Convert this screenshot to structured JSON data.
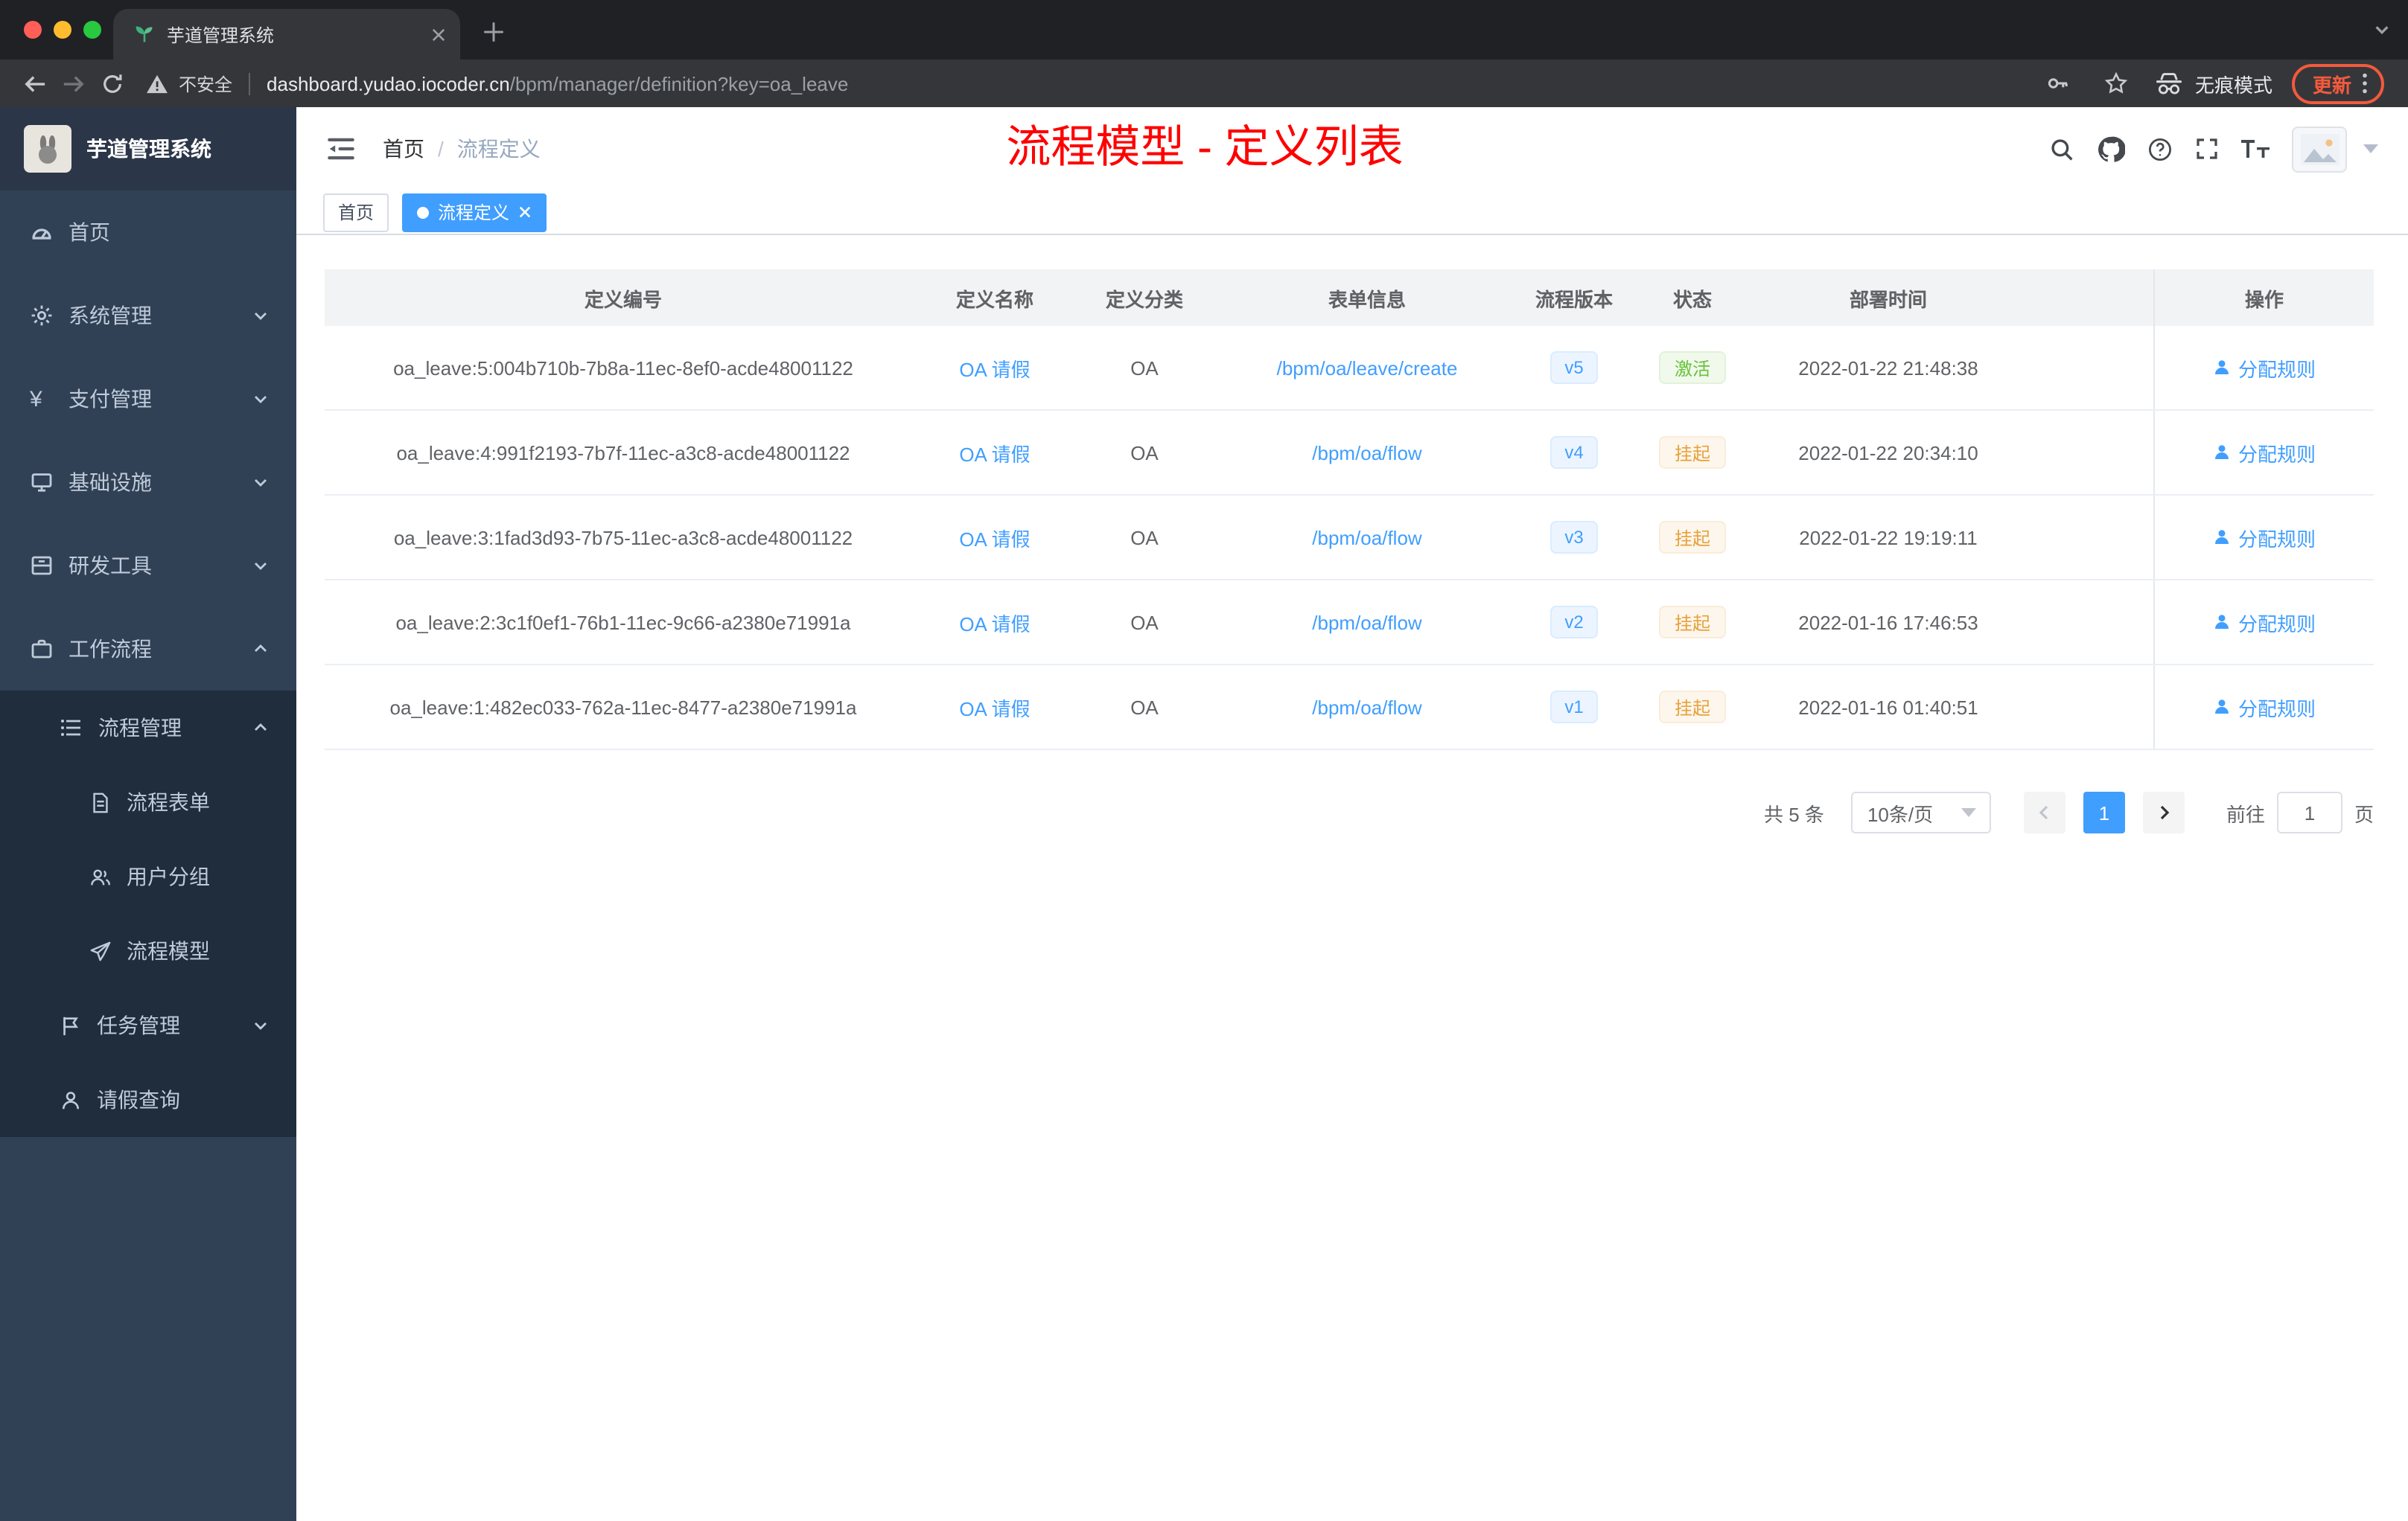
{
  "colors": {
    "accent": "#409eff",
    "success": "#67c23a",
    "warning": "#e6a23c",
    "page_title_red": "#ff0000",
    "update_badge": "#f25a3c",
    "sidebar_bg": "#304156",
    "submenu_bg": "#1f2d3d"
  },
  "browser": {
    "tab_title": "芋道管理系统",
    "security_label": "不安全",
    "url_host": "dashboard.yudao.iocoder.cn",
    "url_path": "/bpm/manager/definition?key=oa_leave",
    "incognito_label": "无痕模式",
    "update_label": "更新"
  },
  "sidebar": {
    "logo_title": "芋道管理系统",
    "items": [
      {
        "label": "首页"
      },
      {
        "label": "系统管理"
      },
      {
        "label": "支付管理"
      },
      {
        "label": "基础设施"
      },
      {
        "label": "研发工具"
      },
      {
        "label": "工作流程"
      },
      {
        "label": "流程管理"
      },
      {
        "label": "流程表单"
      },
      {
        "label": "用户分组"
      },
      {
        "label": "流程模型"
      },
      {
        "label": "任务管理"
      },
      {
        "label": "请假查询"
      }
    ]
  },
  "navbar": {
    "breadcrumb": [
      {
        "label": "首页"
      },
      {
        "label": "流程定义"
      }
    ],
    "separator": "/",
    "title": "流程模型 - 定义列表"
  },
  "tags_view": [
    {
      "label": "首页"
    },
    {
      "label": "流程定义"
    }
  ],
  "table": {
    "columns": [
      "定义编号",
      "定义名称",
      "定义分类",
      "表单信息",
      "流程版本",
      "状态",
      "部署时间",
      "操作"
    ],
    "rows": [
      {
        "id": "oa_leave:5:004b710b-7b8a-11ec-8ef0-acde48001122",
        "name": "OA 请假",
        "category": "OA",
        "form": "/bpm/oa/leave/create",
        "version": "v5",
        "status": "激活",
        "deployed": "2022-01-22 21:48:38",
        "action": "分配规则"
      },
      {
        "id": "oa_leave:4:991f2193-7b7f-11ec-a3c8-acde48001122",
        "name": "OA 请假",
        "category": "OA",
        "form": "/bpm/oa/flow",
        "version": "v4",
        "status": "挂起",
        "deployed": "2022-01-22 20:34:10",
        "action": "分配规则"
      },
      {
        "id": "oa_leave:3:1fad3d93-7b75-11ec-a3c8-acde48001122",
        "name": "OA 请假",
        "category": "OA",
        "form": "/bpm/oa/flow",
        "version": "v3",
        "status": "挂起",
        "deployed": "2022-01-22 19:19:11",
        "action": "分配规则"
      },
      {
        "id": "oa_leave:2:3c1f0ef1-76b1-11ec-9c66-a2380e71991a",
        "name": "OA 请假",
        "category": "OA",
        "form": "/bpm/oa/flow",
        "version": "v2",
        "status": "挂起",
        "deployed": "2022-01-16 17:46:53",
        "action": "分配规则"
      },
      {
        "id": "oa_leave:1:482ec033-762a-11ec-8477-a2380e71991a",
        "name": "OA 请假",
        "category": "OA",
        "form": "/bpm/oa/flow",
        "version": "v1",
        "status": "挂起",
        "deployed": "2022-01-16 01:40:51",
        "action": "分配规则"
      }
    ]
  },
  "pagination": {
    "total": "共 5 条",
    "page_size": "10条/页",
    "page": "1",
    "goto": "前往",
    "goto_value": "1",
    "unit": "页"
  }
}
